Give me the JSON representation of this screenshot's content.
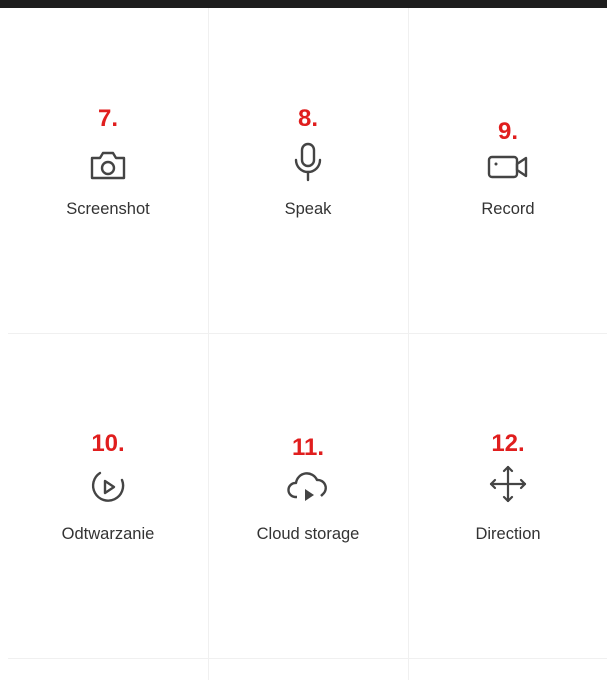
{
  "colors": {
    "accent_number": "#e01e1e",
    "label_text": "#333333",
    "icon_stroke": "#444444",
    "divider": "#f0f0f0",
    "topbar": "#1e1e1e"
  },
  "controls": [
    {
      "number": "7.",
      "label": "Screenshot",
      "icon": "camera-icon"
    },
    {
      "number": "8.",
      "label": "Speak",
      "icon": "microphone-icon"
    },
    {
      "number": "9.",
      "label": "Record",
      "icon": "video-camera-icon"
    },
    {
      "number": "10.",
      "label": "Odtwarzanie",
      "icon": "playback-icon"
    },
    {
      "number": "11.",
      "label": "Cloud storage",
      "icon": "cloud-play-icon"
    },
    {
      "number": "12.",
      "label": "Direction",
      "icon": "direction-arrows-icon"
    }
  ]
}
